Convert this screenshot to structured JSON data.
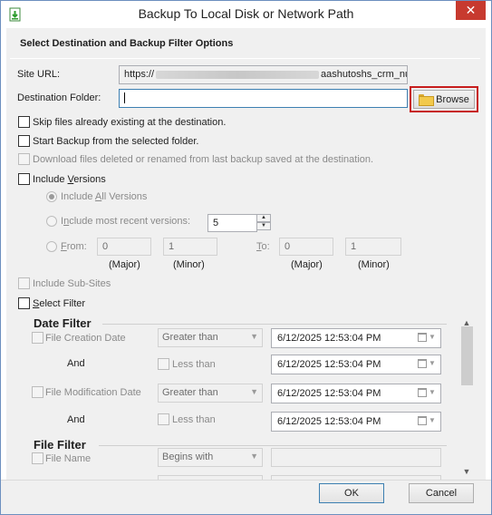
{
  "window": {
    "title": "Backup To Local Disk or Network Path",
    "close_glyph": "✕"
  },
  "section_title": "Select Destination and Backup Filter Options",
  "site_url": {
    "label": "Site URL:",
    "value_prefix": "https://",
    "value_suffix": "aashutoshs_crm_nu"
  },
  "destination": {
    "label": "Destination Folder:",
    "value": "",
    "browse_label": "Browse"
  },
  "options": {
    "skip_existing": "Skip files already existing at the destination.",
    "start_from_selected": "Start Backup from the selected folder.",
    "download_deleted": "Download files deleted or renamed from last backup saved at the destination."
  },
  "versions": {
    "include_versions_pre": "Include ",
    "include_versions_u": "V",
    "include_versions_post": "ersions",
    "all_pre": "Include ",
    "all_u": "A",
    "all_post": "ll Versions",
    "recent_pre": "I",
    "recent_u": "n",
    "recent_post": "clude most recent versions:",
    "recent_count": "5",
    "from_u": "F",
    "from_post": "rom:",
    "to_u": "T",
    "to_post": "o:",
    "from_major": "0",
    "from_minor": "1",
    "to_major": "0",
    "to_minor": "1",
    "major_label": "(Major)",
    "minor_label": "(Minor)"
  },
  "include_subsites": "Include Sub-Sites",
  "select_filter_pre": "",
  "select_filter_u": "S",
  "select_filter_post": "elect Filter",
  "date_filter": {
    "heading": "Date Filter",
    "creation_label": "File Creation Date",
    "modification_label": "File Modification Date",
    "and_label": "And",
    "greater_than": "Greater than",
    "less_than": "Less than",
    "date1": "6/12/2025 12:53:04 PM",
    "date2": "6/12/2025 12:53:04 PM",
    "date3": "6/12/2025 12:53:04 PM",
    "date4": "6/12/2025 12:53:04 PM"
  },
  "file_filter": {
    "heading": "File Filter",
    "file_name_label": "File Name",
    "begins_with": "Begins with"
  },
  "buttons": {
    "ok": "OK",
    "cancel": "Cancel"
  },
  "colors": {
    "highlight": "#c71d1d",
    "close_bg": "#c73a2f",
    "window_border": "#6c8fbf"
  },
  "icons": {
    "app": "backup-app-icon",
    "folder": "folder-icon",
    "calendar": "calendar-icon"
  }
}
